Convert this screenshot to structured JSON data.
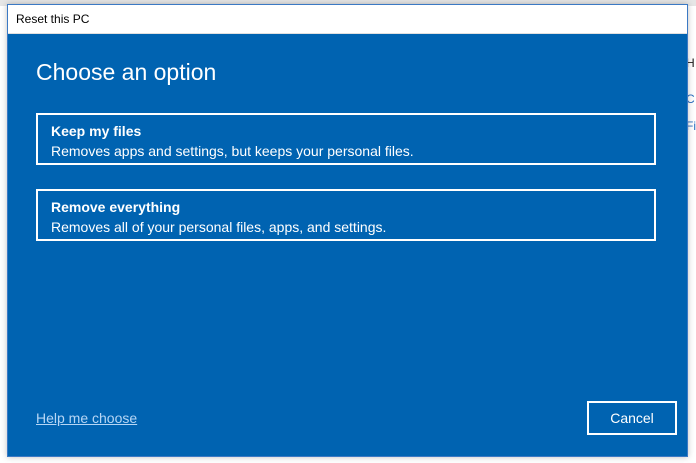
{
  "window": {
    "title": "Reset this PC"
  },
  "dialog": {
    "heading": "Choose an option",
    "options": [
      {
        "title": "Keep my files",
        "description": "Removes apps and settings, but keeps your personal files."
      },
      {
        "title": "Remove everything",
        "description": "Removes all of your personal files, apps, and settings."
      }
    ],
    "help_link": "Help me choose",
    "cancel_label": "Cancel"
  },
  "colors": {
    "dialog_background": "#0063b1",
    "text": "#ffffff",
    "link": "#b6d6f5"
  },
  "background_fragments": [
    "H",
    "C",
    "Fi"
  ]
}
